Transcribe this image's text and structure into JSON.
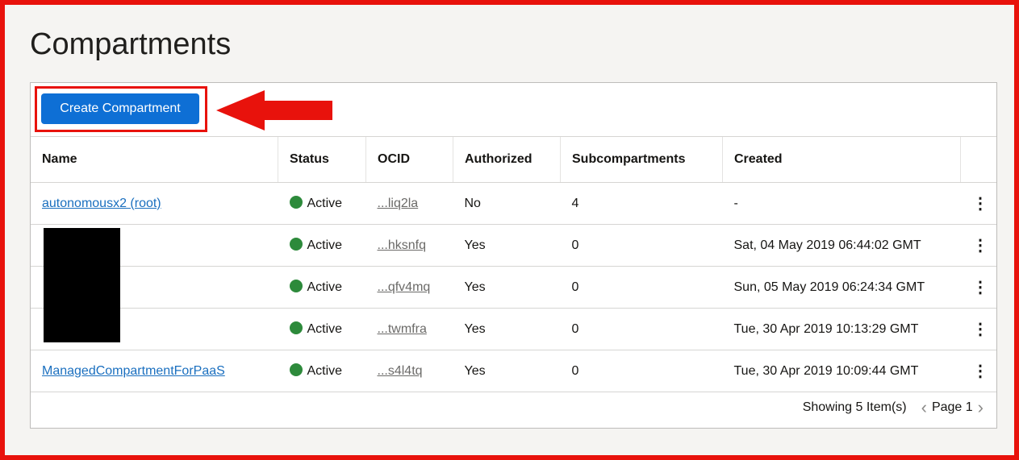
{
  "page": {
    "title": "Compartments"
  },
  "toolbar": {
    "create_label": "Create Compartment"
  },
  "colors": {
    "accent": "#0e6fd5",
    "highlight": "#e8120c",
    "active": "#2d8a3b"
  },
  "table": {
    "columns": [
      "Name",
      "Status",
      "OCID",
      "Authorized",
      "Subcompartments",
      "Created"
    ],
    "rows": [
      {
        "name": "autonomousx2 (root)",
        "status": "Active",
        "ocid": "...liq2la",
        "authorized": "No",
        "subcompartments": "4",
        "created": "-"
      },
      {
        "name": "",
        "status": "Active",
        "ocid": "...hksnfq",
        "authorized": "Yes",
        "subcompartments": "0",
        "created": "Sat, 04 May 2019 06:44:02 GMT"
      },
      {
        "name": "",
        "status": "Active",
        "ocid": "...qfv4mq",
        "authorized": "Yes",
        "subcompartments": "0",
        "created": "Sun, 05 May 2019 06:24:34 GMT"
      },
      {
        "name": "",
        "status": "Active",
        "ocid": "...twmfra",
        "authorized": "Yes",
        "subcompartments": "0",
        "created": "Tue, 30 Apr 2019 10:13:29 GMT"
      },
      {
        "name": "ManagedCompartmentForPaaS",
        "status": "Active",
        "ocid": "...s4l4tq",
        "authorized": "Yes",
        "subcompartments": "0",
        "created": "Tue, 30 Apr 2019 10:09:44 GMT"
      }
    ],
    "row_action_icon": "kebab-menu-icon"
  },
  "footer": {
    "showing": "Showing 5 Item(s)",
    "page": "Page 1"
  }
}
